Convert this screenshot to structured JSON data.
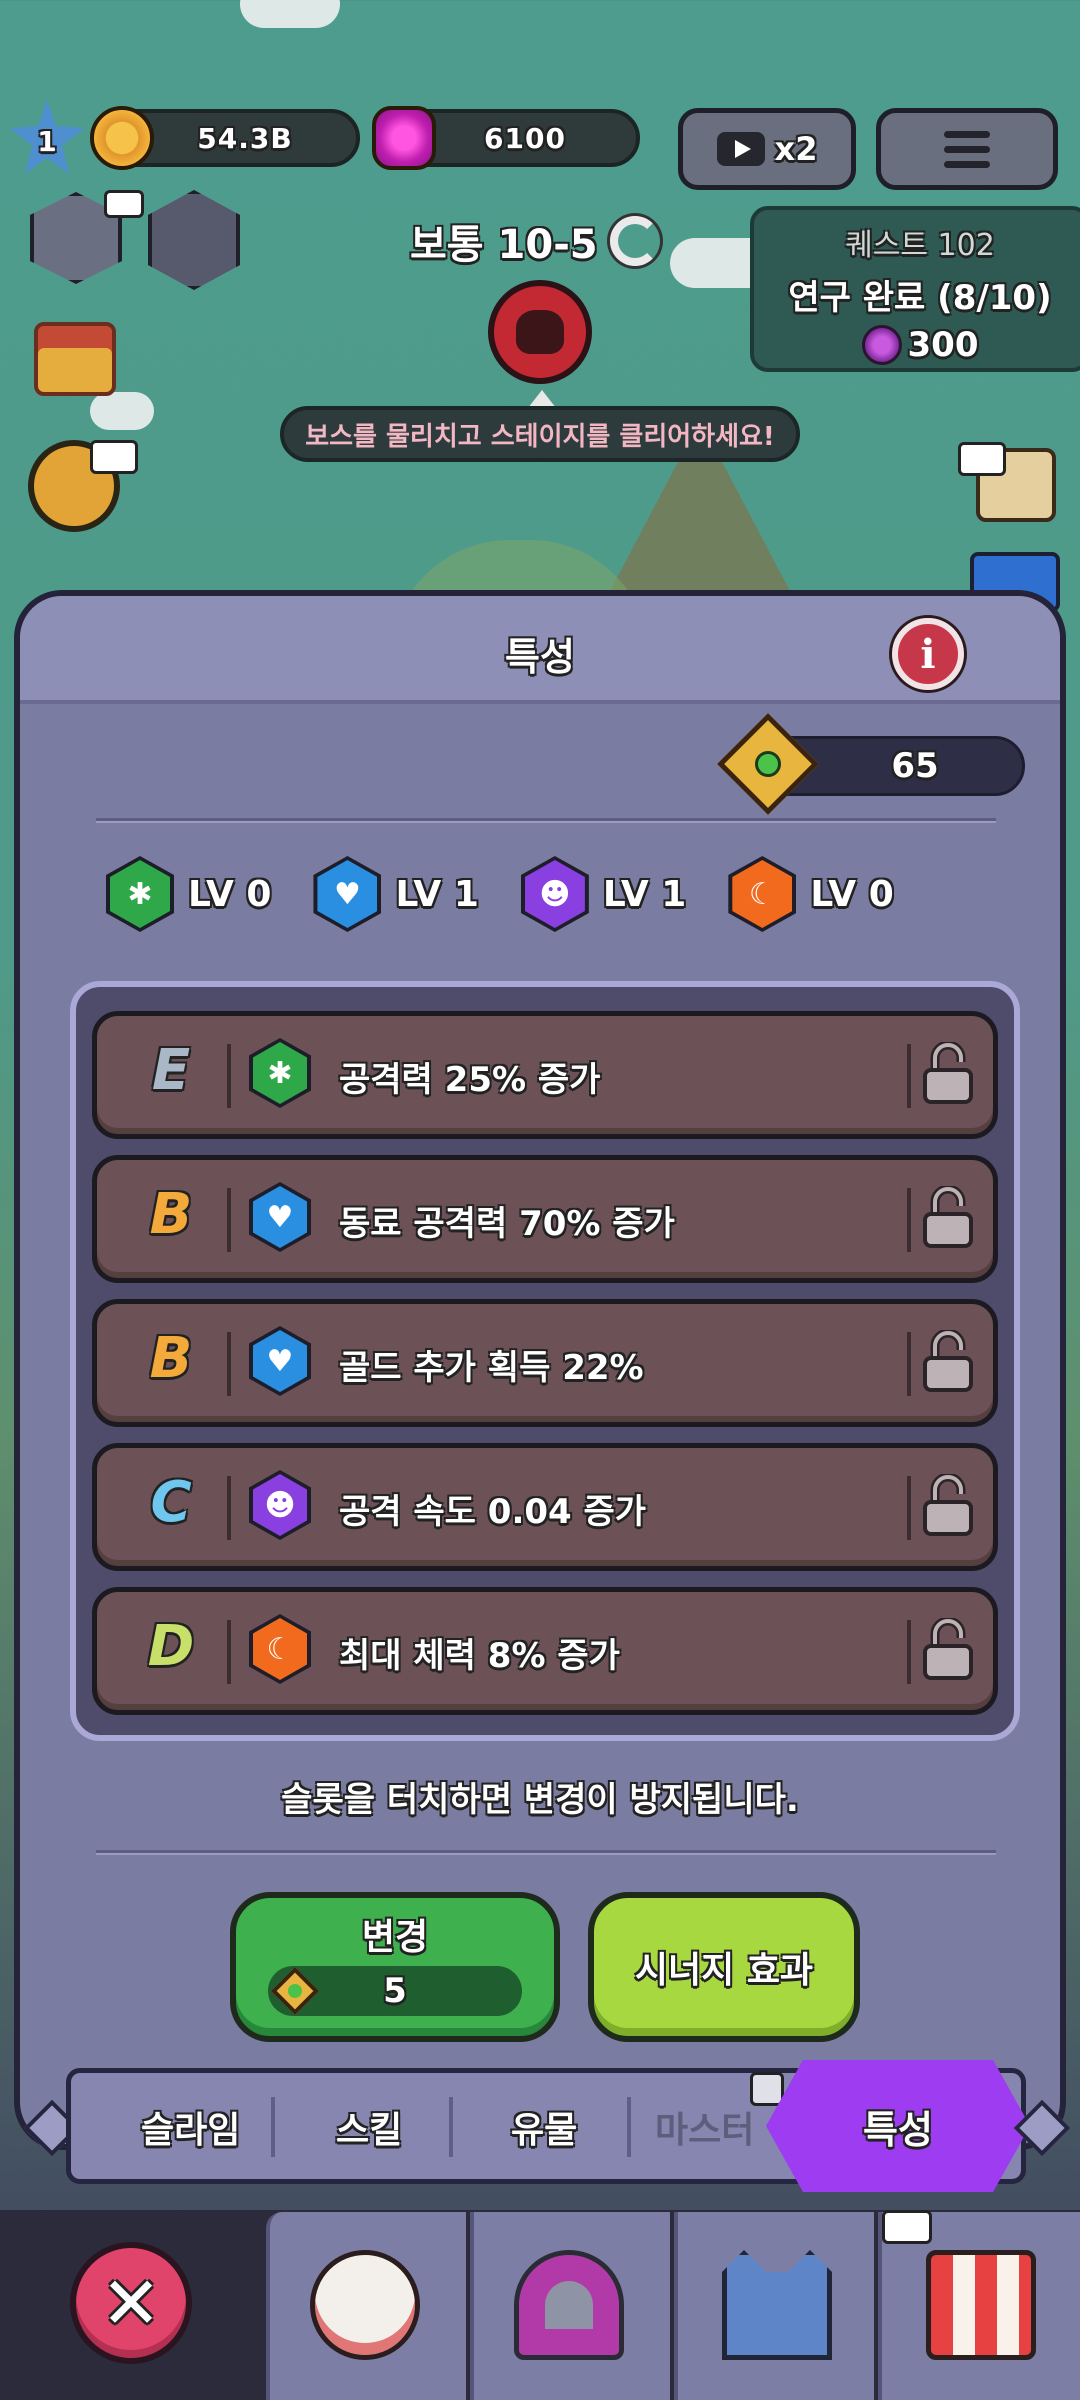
{
  "hud": {
    "player_level": "1",
    "gold": "54.3B",
    "gems": "6100",
    "ad_multiplier": "x2"
  },
  "stage": {
    "title": "보통 10-5",
    "boss_banner": "보스를 물리치고 스테이지를 클리어하세요!"
  },
  "quest": {
    "title": "퀘스트 102",
    "desc": "연구 완료 (8/10)",
    "reward": "300"
  },
  "panel": {
    "title": "특성",
    "trait_gems": "65",
    "levels": [
      {
        "label": "LV 0",
        "color": "#2fa84a"
      },
      {
        "label": "LV 1",
        "color": "#2a8fe0"
      },
      {
        "label": "LV 1",
        "color": "#8a3fe0"
      },
      {
        "label": "LV 0",
        "color": "#f26a1e"
      }
    ],
    "slots": [
      {
        "grade": "E",
        "grade_color": "#aab7c6",
        "stat": "공격력 25% 증가",
        "icon_color": "#2fa84a"
      },
      {
        "grade": "B",
        "grade_color": "#f4a93b",
        "stat": "동료 공격력 70% 증가",
        "icon_color": "#2a8fe0"
      },
      {
        "grade": "B",
        "grade_color": "#f4a93b",
        "stat": "골드 추가 획득 22%",
        "icon_color": "#2a8fe0"
      },
      {
        "grade": "C",
        "grade_color": "#6fc7f0",
        "stat": "공격 속도 0.04 증가",
        "icon_color": "#8a3fe0"
      },
      {
        "grade": "D",
        "grade_color": "#c8e06a",
        "stat": "최대 체력 8% 증가",
        "icon_color": "#f26a1e"
      }
    ],
    "hint": "슬롯을 터치하면 변경이 방지됩니다.",
    "change_label": "변경",
    "change_cost": "5",
    "synergy_label": "시너지 효과"
  },
  "tabs": [
    "슬라임",
    "스킬",
    "유물",
    "마스터",
    "특성"
  ],
  "icons": {
    "star": "star-icon",
    "coin": "coin-icon",
    "gem": "gem-icon",
    "skull": "boss-skull-icon",
    "lock": "unlock-icon"
  }
}
